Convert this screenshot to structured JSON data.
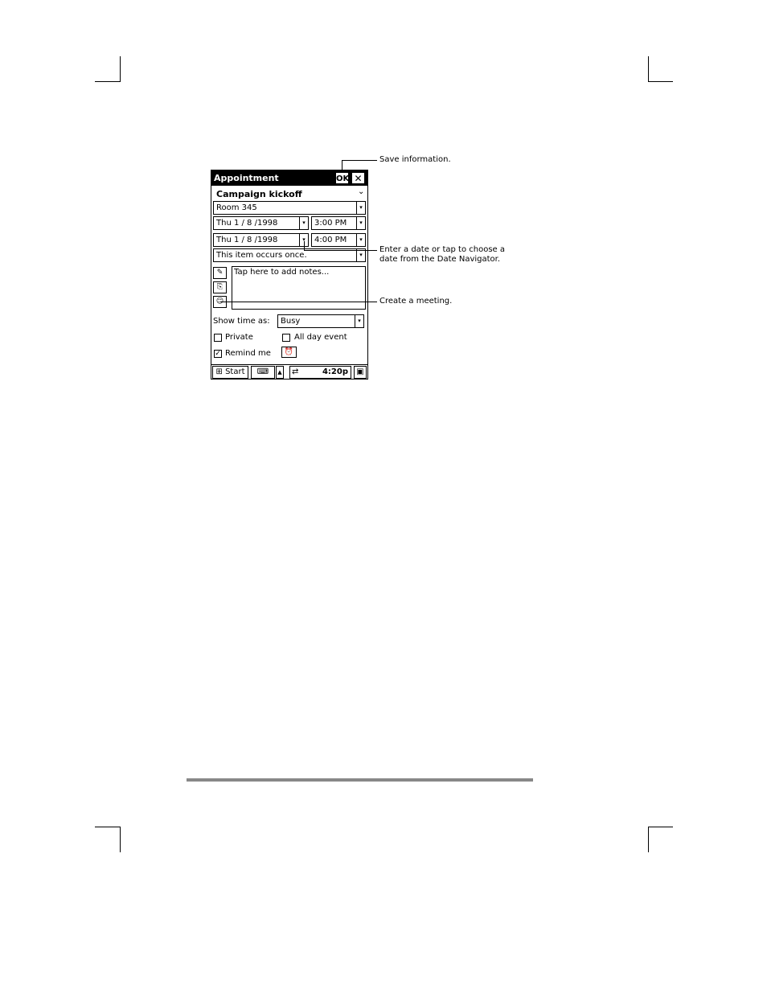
{
  "window": {
    "title": "Appointment",
    "ok_label": "OK",
    "close_label": "✕"
  },
  "form": {
    "subject": "Campaign kickoff",
    "location": "Room 345",
    "start_date": "Thu   1 / 8 /1998",
    "start_time": "3:00 PM",
    "end_date": "Thu   1 / 8 /1998",
    "end_time": "4:00 PM",
    "recurrence": "This item occurs once.",
    "notes_placeholder": "Tap here to add notes...",
    "show_time_label": "Show time as:",
    "show_time_value": "Busy",
    "private_label": "Private",
    "all_day_label": "All day event",
    "remind_label": "Remind me",
    "remind_checked": true
  },
  "taskbar": {
    "start_label": "Start",
    "clock": "4:20p"
  },
  "callouts": {
    "save": "Save information.",
    "date_line1": "Enter a date or tap to choose a",
    "date_line2": "date from the Date Navigator.",
    "meeting": "Create a meeting."
  },
  "icons": {
    "dropdown": "▾",
    "checkmark": "✓",
    "windows_logo": "⊞",
    "keyboard": "⌨",
    "up_arrow": "▲",
    "alarm": "⏰",
    "pencil": "✎",
    "attach": "⎘",
    "meeting": "☺",
    "connect": "⇄",
    "desktop": "▣"
  }
}
